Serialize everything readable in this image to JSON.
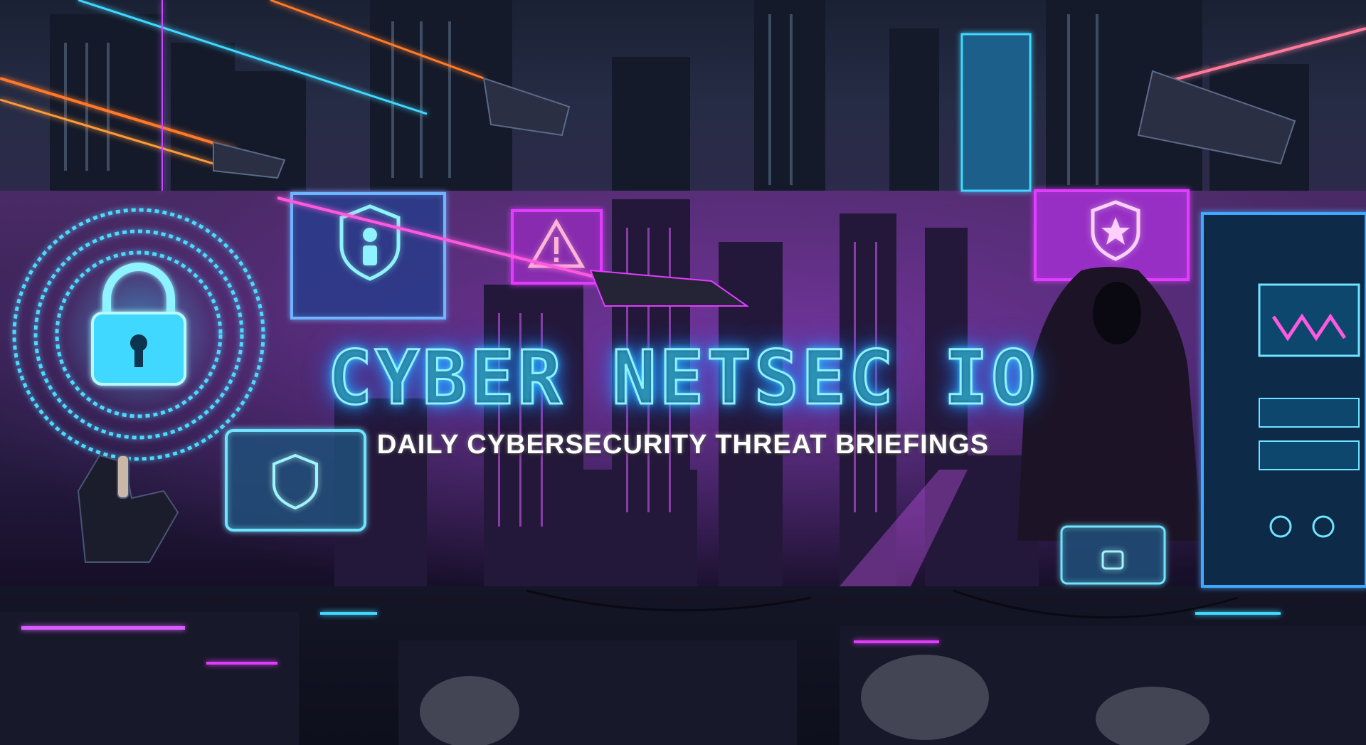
{
  "banner": {
    "title": "CYBER NETSEC IO",
    "subtitle": "DAILY CYBERSECURITY THREAT BRIEFINGS"
  },
  "palette": {
    "neon_cyan": "#3fd8ff",
    "neon_magenta": "#e23cff",
    "neon_orange": "#ff7a2a",
    "sky": "#262c45",
    "city_dark": "#0b0d1c"
  },
  "icons": [
    "padlock-icon",
    "shield-user-icon",
    "warning-triangle-icon",
    "shield-star-icon",
    "shield-icon",
    "hooded-hacker-figure",
    "robot-hand"
  ]
}
